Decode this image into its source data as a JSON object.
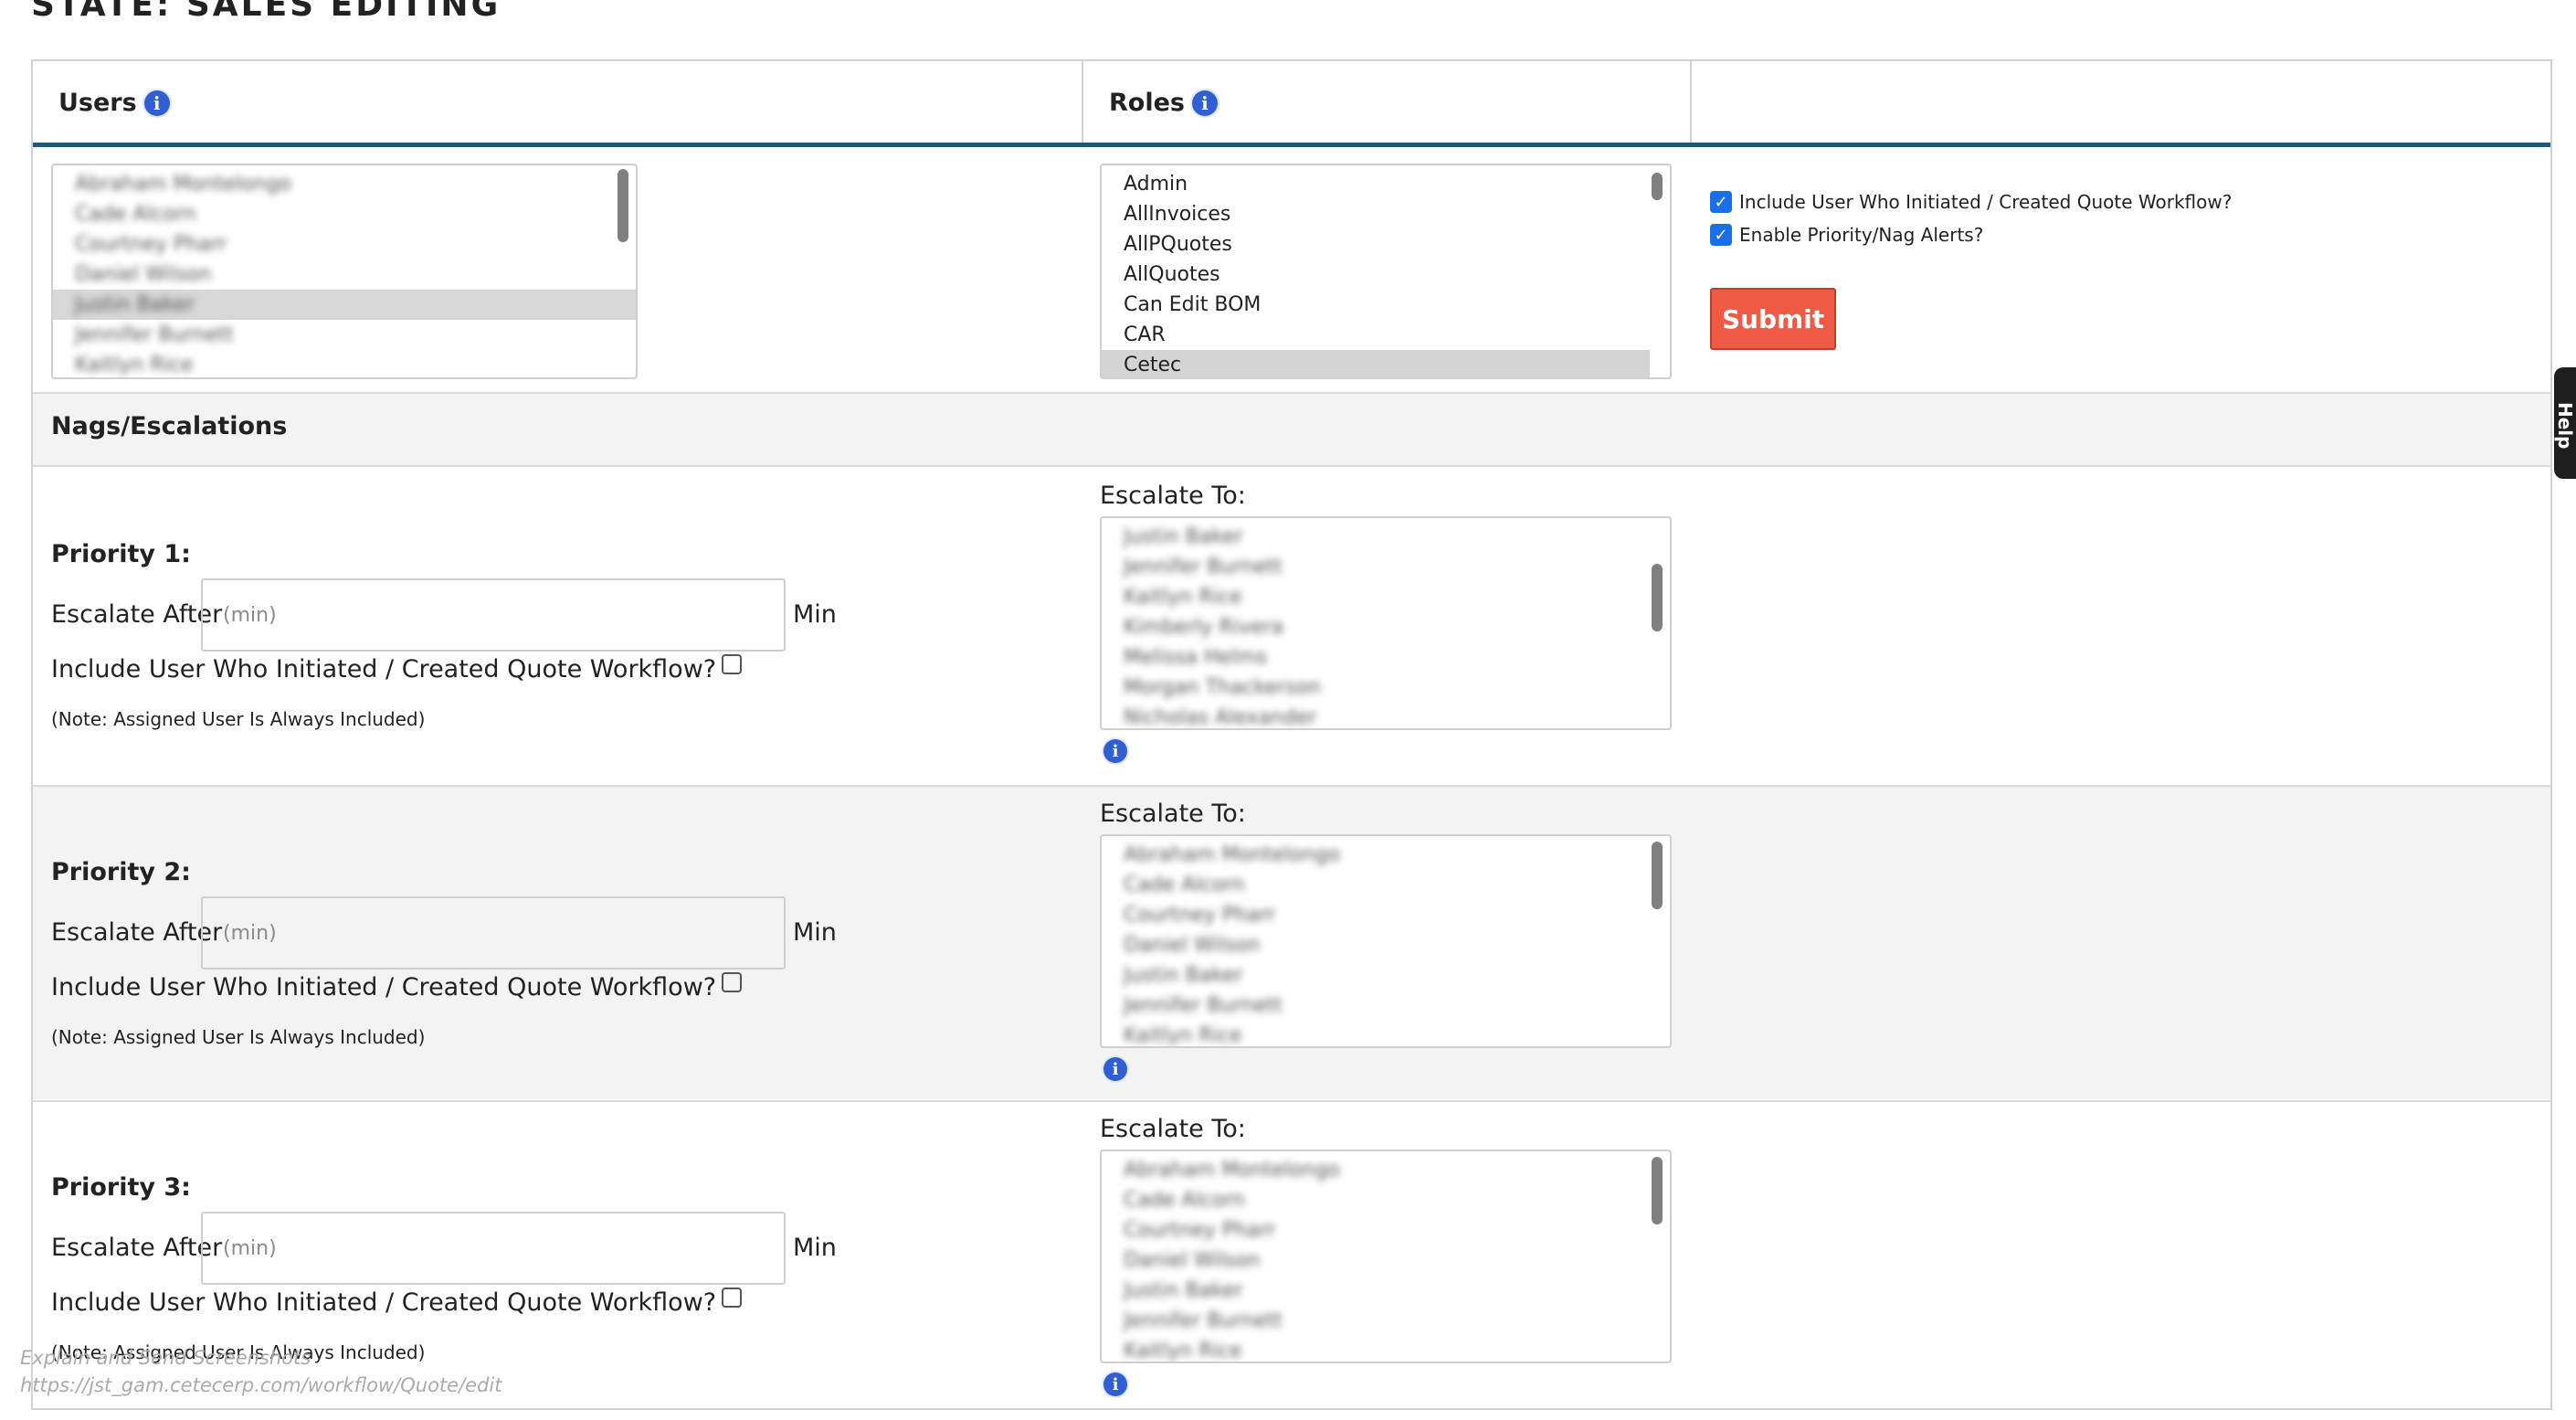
{
  "page": {
    "title": "STATE: SALES EDITING"
  },
  "header": {
    "users_label": "Users",
    "roles_label": "Roles"
  },
  "users_list": {
    "items": [
      "Abraham Montelongo",
      "Cade Alcorn",
      "Courtney Pharr",
      "Daniel Wilson",
      "Justin Baker",
      "Jennifer Burnett",
      "Kaitlyn Rice"
    ],
    "selected_index": 4
  },
  "roles_list": {
    "items": [
      "Admin",
      "AllInvoices",
      "AllPQuotes",
      "AllQuotes",
      "Can Edit BOM",
      "CAR",
      "Cetec"
    ],
    "selected_index": 6
  },
  "options": {
    "include_user_label": "Include User Who Initiated / Created Quote Workflow?",
    "include_user_checked": true,
    "enable_alerts_label": "Enable Priority/Nag Alerts?",
    "enable_alerts_checked": true,
    "submit_label": "Submit"
  },
  "nags": {
    "title": "Nags/Escalations"
  },
  "priorities": [
    {
      "title": "Priority 1:",
      "escalate_after_label": "Escalate After",
      "placeholder": "(min)",
      "unit": "Min",
      "include_label": "Include User Who Initiated / Created Quote Workflow?",
      "include_checked": false,
      "note": "(Note: Assigned User Is Always Included)",
      "escalate_to_label": "Escalate To:",
      "escalate_list": [
        "Justin Baker",
        "Jennifer Burnett",
        "Kaitlyn Rice",
        "Kimberly Rivera",
        "Melissa Helms",
        "Morgan Thackerson",
        "Nicholas Alexander"
      ]
    },
    {
      "title": "Priority 2:",
      "escalate_after_label": "Escalate After",
      "placeholder": "(min)",
      "unit": "Min",
      "include_label": "Include User Who Initiated / Created Quote Workflow?",
      "include_checked": false,
      "note": "(Note: Assigned User Is Always Included)",
      "escalate_to_label": "Escalate To:",
      "escalate_list": [
        "Abraham Montelongo",
        "Cade Alcorn",
        "Courtney Pharr",
        "Daniel Wilson",
        "Justin Baker",
        "Jennifer Burnett",
        "Kaitlyn Rice"
      ]
    },
    {
      "title": "Priority 3:",
      "escalate_after_label": "Escalate After",
      "placeholder": "(min)",
      "unit": "Min",
      "include_label": "Include User Who Initiated / Created Quote Workflow?",
      "include_checked": false,
      "note": "(Note: Assigned User Is Always Included)",
      "escalate_to_label": "Escalate To:",
      "escalate_list": [
        "Abraham Montelongo",
        "Cade Alcorn",
        "Courtney Pharr",
        "Daniel Wilson",
        "Justin Baker",
        "Jennifer Burnett",
        "Kaitlyn Rice"
      ]
    }
  ],
  "help_tab": {
    "label": "Help"
  },
  "footer": {
    "caption": "Explain and Send Screenshots",
    "url": "https://jst_gam.cetecerp.com/workflow/Quote/edit"
  },
  "colors": {
    "accent_line": "#1d5a7a",
    "submit": "#ee5a45",
    "info_icon": "#2f5fd0",
    "checkbox": "#1a6ee6"
  },
  "icons": {
    "info": "info-icon"
  }
}
